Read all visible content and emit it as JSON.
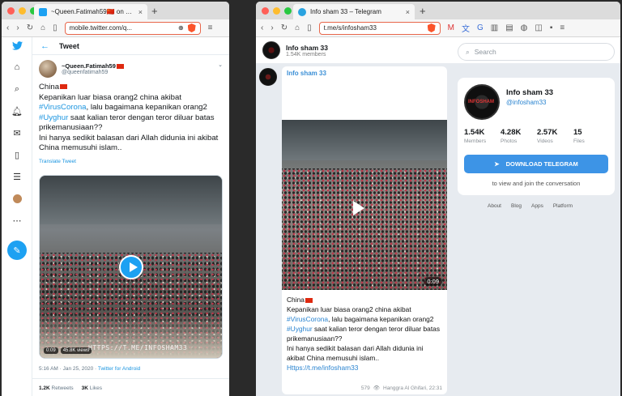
{
  "left_window": {
    "tab": {
      "title": "~Queen.Fatimah59🇨🇳 on Twitter..."
    },
    "url": "mobile.twitter.com/q...",
    "header": {
      "title": "Tweet"
    },
    "user": {
      "name": "~Queen.Fatimah59",
      "handle": "@queenfatimah59"
    },
    "tweet": {
      "line1": "China",
      "line2": "Kepanikan luar biasa orang2 china akibat",
      "hashtag1": "#VirusCorona",
      "line3": ", lalu bagaimana kepanikan orang2",
      "hashtag2": "#Uyghur",
      "line4": " saat kalian teror dengan teror diluar batas prikemanusiaan??",
      "line5": "Ini hanya sedikit balasan dari Allah didunia ini akibat China memusuhi islam.."
    },
    "translate": "Translate Tweet",
    "video": {
      "time": "0:09",
      "views": "45.8K views",
      "watermark": "HTTPS://T.ME/INFOSHAM33"
    },
    "meta": {
      "time": "5:16 AM · Jan 25, 2020 · ",
      "source": "Twitter for Android"
    },
    "stats": {
      "retweets_count": "1.2K",
      "retweets_label": "Retweets",
      "likes_count": "3K",
      "likes_label": "Likes"
    }
  },
  "right_window": {
    "tab": {
      "title": "Info sham 33 – Telegram"
    },
    "url": "t.me/s/infosham33",
    "header": {
      "title": "Info sham 33",
      "members": "1.54K members"
    },
    "search": {
      "placeholder": "Search"
    },
    "message": {
      "author": "Info sham 33",
      "duration": "0:09",
      "line1": "China",
      "line2": "Kepanikan luar biasa orang2 china akibat",
      "hashtag1": "#VirusCorona",
      "line3": ", lalu bagaimana kepanikan orang2",
      "hashtag2": "#Uyghur",
      "line4": " saat kalian teror dengan teror diluar batas prikemanusiaan??",
      "line5": "Ini hanya sedikit balasan dari Allah didunia ini akibat China memusuhi islam..",
      "link": "Https://t.me/infosham33",
      "views": "579",
      "signature": "Hanggra Al Ghifari, 22:31"
    },
    "card": {
      "title": "Info sham 33",
      "handle": "@infosham33",
      "avatar_text": "INFOSHAM",
      "counters": [
        {
          "num": "1.54K",
          "label": "Members"
        },
        {
          "num": "4.28K",
          "label": "Photos"
        },
        {
          "num": "2.57K",
          "label": "Videos"
        },
        {
          "num": "15",
          "label": "Files"
        }
      ],
      "download": "DOWNLOAD TELEGRAM",
      "view_text": "to view and join the conversation"
    },
    "footer_links": [
      "About",
      "Blog",
      "Apps",
      "Platform"
    ]
  },
  "colors": {
    "twitter_blue": "#1da1f2",
    "telegram_blue": "#3d94e6",
    "link_blue": "#2a84d0"
  }
}
